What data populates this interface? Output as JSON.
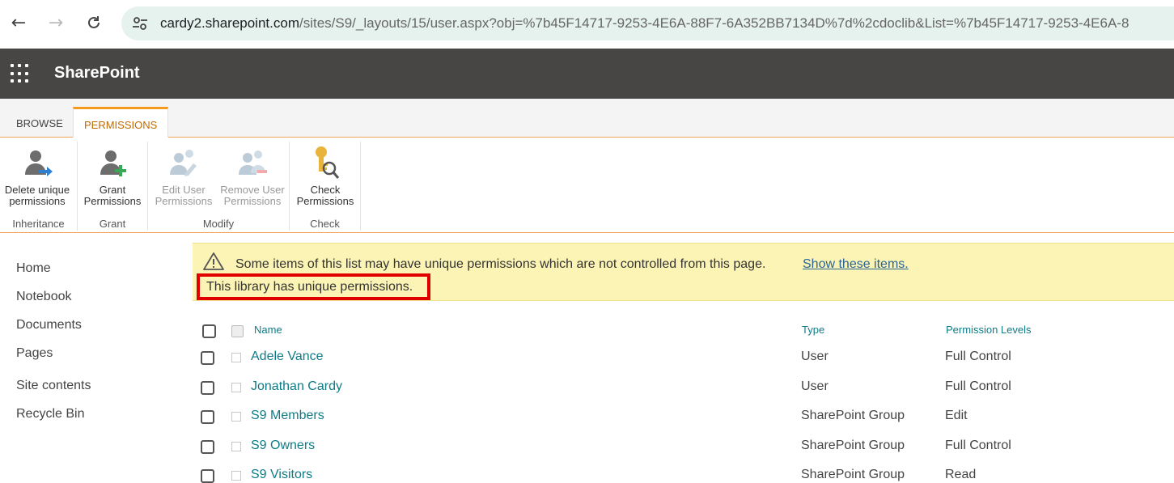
{
  "browser": {
    "back_icon": "arrow-left-icon",
    "forward_icon": "arrow-right-icon",
    "reload_icon": "reload-icon",
    "url_host": "cardy2.sharepoint.com",
    "url_path": "/sites/S9/_layouts/15/user.aspx?obj=%7b45F14717-9253-4E6A-88F7-6A352BB7134D%7d%2cdoclib&List=%7b45F14717-9253-4E6A-8"
  },
  "suite_bar": {
    "app_launcher_icon": "waffle-icon",
    "brand": "SharePoint",
    "color": "#484644"
  },
  "ribbon": {
    "tabs": [
      {
        "label": "BROWSE",
        "active": false
      },
      {
        "label": "PERMISSIONS",
        "active": true
      }
    ],
    "groups": [
      {
        "label": "Inheritance",
        "buttons": [
          {
            "line1": "Delete unique",
            "line2": "permissions",
            "enabled": true,
            "icon": "delete-unique-permissions-icon"
          }
        ]
      },
      {
        "label": "Grant",
        "buttons": [
          {
            "line1": "Grant",
            "line2": "Permissions",
            "enabled": true,
            "icon": "grant-permissions-icon"
          }
        ]
      },
      {
        "label": "Modify",
        "buttons": [
          {
            "line1": "Edit User",
            "line2": "Permissions",
            "enabled": false,
            "icon": "edit-user-permissions-icon"
          },
          {
            "line1": "Remove User",
            "line2": "Permissions",
            "enabled": false,
            "icon": "remove-user-permissions-icon"
          }
        ]
      },
      {
        "label": "Check",
        "buttons": [
          {
            "line1": "Check",
            "line2": "Permissions",
            "enabled": true,
            "icon": "check-permissions-icon"
          }
        ]
      }
    ],
    "accent": "#f49a1f"
  },
  "left_nav": {
    "items": [
      "Home",
      "Notebook",
      "Documents",
      "Pages",
      "Site contents",
      "Recycle Bin"
    ]
  },
  "message": {
    "warning": "Some items of this list may have unique permissions which are not controlled from this page.",
    "link": "Show these items.",
    "unique": "This library has unique permissions.",
    "highlight_color": "#e00000"
  },
  "table": {
    "headers": {
      "name": "Name",
      "type": "Type",
      "permission": "Permission Levels"
    },
    "rows": [
      {
        "name": "Adele Vance",
        "type": "User",
        "permission": "Full Control"
      },
      {
        "name": "Jonathan Cardy",
        "type": "User",
        "permission": "Full Control"
      },
      {
        "name": "S9 Members",
        "type": "SharePoint Group",
        "permission": "Edit"
      },
      {
        "name": "S9 Owners",
        "type": "SharePoint Group",
        "permission": "Full Control"
      },
      {
        "name": "S9 Visitors",
        "type": "SharePoint Group",
        "permission": "Read"
      }
    ],
    "link_color": "#0f7b87"
  }
}
